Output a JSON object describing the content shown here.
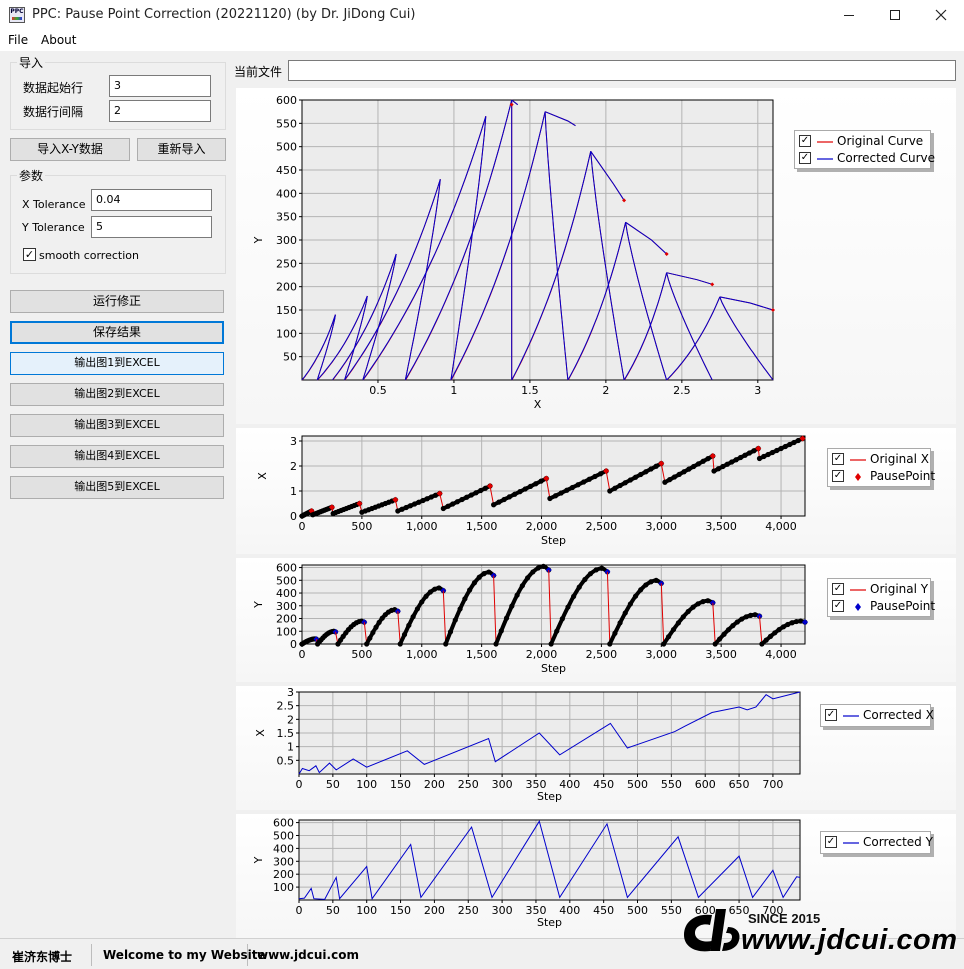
{
  "window": {
    "title": "PPC: Pause Point Correction (20221120) (by Dr. JiDong Cui)",
    "icon": "ppc-app-icon",
    "icon_text": "PPC"
  },
  "menu": {
    "file": "File",
    "about": "About"
  },
  "import_group": {
    "title": "导入",
    "start_row_label": "数据起始行",
    "start_row_value": "3",
    "row_interval_label": "数据行间隔",
    "row_interval_value": "2"
  },
  "buttons": {
    "import_xy": "导入X-Y数据",
    "reimport": "重新导入",
    "run": "运行修正",
    "save": "保存结果",
    "export1": "输出图1到EXCEL",
    "export2": "输出图2到EXCEL",
    "export3": "输出图3到EXCEL",
    "export4": "输出图4到EXCEL",
    "export5": "输出图5到EXCEL"
  },
  "params_group": {
    "title": "参数",
    "x_tol_label": "X Tolerance",
    "x_tol_value": "0.04",
    "y_tol_label": "Y Tolerance",
    "y_tol_value": "5",
    "smooth_label": "smooth correction",
    "smooth_checked": true
  },
  "current_file": {
    "label": "当前文件",
    "value": ""
  },
  "status": {
    "name": "崔济东博士",
    "welcome": "Welcome to my Website",
    "site": "www.jdcui.com"
  },
  "watermark": {
    "since": "SINCE 2015",
    "site": "www.jdcui.com"
  },
  "colors": {
    "red": "#e00000",
    "blue": "#0000cc",
    "black": "#000000",
    "focus": "#0078d7"
  },
  "chart_data": [
    {
      "type": "line",
      "xlabel": "X",
      "ylabel": "Y",
      "xlim": [
        0,
        3.1
      ],
      "ylim": [
        0,
        600
      ],
      "xticks": [
        0.5,
        1,
        1.5,
        2,
        2.5,
        3
      ],
      "yticks": [
        50,
        100,
        150,
        200,
        250,
        300,
        350,
        400,
        450,
        500,
        550,
        600
      ],
      "series": [
        {
          "name": "Original Curve",
          "color": "#e00000",
          "legend_checked": true
        },
        {
          "name": "Corrected Curve",
          "color": "#0000cc",
          "legend_checked": true
        }
      ],
      "peaks": [
        {
          "x": 0.22,
          "y": 140
        },
        {
          "x": 0.43,
          "y": 180
        },
        {
          "x": 0.62,
          "y": 270
        },
        {
          "x": 0.91,
          "y": 430
        },
        {
          "x": 1.21,
          "y": 565
        },
        {
          "x": 1.38,
          "y": 600
        },
        {
          "x": 1.6,
          "y": 575
        },
        {
          "x": 1.9,
          "y": 490
        },
        {
          "x": 2.13,
          "y": 338
        },
        {
          "x": 2.4,
          "y": 230
        },
        {
          "x": 2.75,
          "y": 178
        }
      ],
      "unload_ends": [
        {
          "x": 0.1,
          "y": 0
        },
        {
          "x": 0.28,
          "y": 0
        },
        {
          "x": 0.4,
          "y": 0
        },
        {
          "x": 0.68,
          "y": 0
        },
        {
          "x": 0.98,
          "y": 0
        },
        {
          "x": 1.38,
          "y": 0
        },
        {
          "x": 1.75,
          "y": 0
        },
        {
          "x": 2.12,
          "y": 0
        },
        {
          "x": 2.4,
          "y": 0
        }
      ],
      "tail_points": [
        {
          "x": 1.42,
          "y": 590
        },
        {
          "x": 1.8,
          "y": 545
        },
        {
          "x": 2.12,
          "y": 385
        },
        {
          "x": 2.4,
          "y": 270
        },
        {
          "x": 2.7,
          "y": 205
        },
        {
          "x": 3.1,
          "y": 150
        }
      ]
    },
    {
      "type": "line",
      "xlabel": "Step",
      "ylabel": "X",
      "xlim": [
        0,
        4200
      ],
      "ylim": [
        0,
        3.2
      ],
      "xticks": [
        "0",
        "500",
        "1,000",
        "1,500",
        "2,000",
        "2,500",
        "3,000",
        "3,500",
        "4,000"
      ],
      "yticks": [
        0,
        1,
        2,
        3
      ],
      "series": [
        {
          "name": "Original X",
          "color": "#e00000",
          "legend_checked": true
        },
        {
          "name": "PausePoint",
          "color": "#e00000",
          "marker": "diamond",
          "legend_checked": true
        }
      ],
      "cycles": [
        {
          "start": 0,
          "end": 80,
          "x0": 0.0,
          "x1": 0.2
        },
        {
          "start": 90,
          "end": 250,
          "x0": 0.05,
          "x1": 0.35
        },
        {
          "start": 260,
          "end": 480,
          "x0": 0.1,
          "x1": 0.5
        },
        {
          "start": 500,
          "end": 780,
          "x0": 0.15,
          "x1": 0.65
        },
        {
          "start": 800,
          "end": 1150,
          "x0": 0.2,
          "x1": 0.9
        },
        {
          "start": 1180,
          "end": 1570,
          "x0": 0.3,
          "x1": 1.2
        },
        {
          "start": 1600,
          "end": 2040,
          "x0": 0.45,
          "x1": 1.5
        },
        {
          "start": 2070,
          "end": 2540,
          "x0": 0.7,
          "x1": 1.8
        },
        {
          "start": 2570,
          "end": 3000,
          "x0": 1.0,
          "x1": 2.1
        },
        {
          "start": 3030,
          "end": 3430,
          "x0": 1.35,
          "x1": 2.4
        },
        {
          "start": 3440,
          "end": 3810,
          "x0": 1.8,
          "x1": 2.7
        },
        {
          "start": 3820,
          "end": 4180,
          "x0": 2.3,
          "x1": 3.1
        }
      ]
    },
    {
      "type": "line",
      "xlabel": "Step",
      "ylabel": "Y",
      "xlim": [
        0,
        4200
      ],
      "ylim": [
        0,
        620
      ],
      "xticks": [
        "0",
        "500",
        "1,000",
        "1,500",
        "2,000",
        "2,500",
        "3,000",
        "3,500",
        "4,000"
      ],
      "yticks": [
        0,
        100,
        200,
        300,
        400,
        500,
        600
      ],
      "series": [
        {
          "name": "Original Y",
          "color": "#e00000",
          "legend_checked": true
        },
        {
          "name": "PausePoint",
          "color": "#0000cc",
          "marker": "diamond",
          "legend_checked": true
        }
      ],
      "cycles": [
        {
          "start": 0,
          "end": 120,
          "peak": 40
        },
        {
          "start": 130,
          "end": 280,
          "peak": 100
        },
        {
          "start": 300,
          "end": 520,
          "peak": 180
        },
        {
          "start": 540,
          "end": 800,
          "peak": 270
        },
        {
          "start": 820,
          "end": 1180,
          "peak": 440
        },
        {
          "start": 1200,
          "end": 1600,
          "peak": 565
        },
        {
          "start": 1620,
          "end": 2060,
          "peak": 610
        },
        {
          "start": 2080,
          "end": 2550,
          "peak": 595
        },
        {
          "start": 2570,
          "end": 3000,
          "peak": 500
        },
        {
          "start": 3020,
          "end": 3430,
          "peak": 340
        },
        {
          "start": 3450,
          "end": 3820,
          "peak": 230
        },
        {
          "start": 3840,
          "end": 4200,
          "peak": 180
        }
      ]
    },
    {
      "type": "line",
      "xlabel": "Step",
      "ylabel": "X",
      "xlim": [
        0,
        740
      ],
      "ylim": [
        0,
        3
      ],
      "xticks": [
        0,
        50,
        100,
        150,
        200,
        250,
        300,
        350,
        400,
        450,
        500,
        550,
        600,
        650,
        700
      ],
      "yticks": [
        0.5,
        1,
        1.5,
        2,
        2.5,
        3
      ],
      "series": [
        {
          "name": "Corrected X",
          "color": "#0000cc",
          "legend_checked": true,
          "points": [
            [
              0,
              0
            ],
            [
              5,
              0.2
            ],
            [
              15,
              0.12
            ],
            [
              25,
              0.3
            ],
            [
              30,
              0.05
            ],
            [
              45,
              0.4
            ],
            [
              55,
              0.15
            ],
            [
              80,
              0.55
            ],
            [
              100,
              0.25
            ],
            [
              160,
              0.85
            ],
            [
              185,
              0.35
            ],
            [
              280,
              1.3
            ],
            [
              290,
              0.45
            ],
            [
              355,
              1.5
            ],
            [
              385,
              0.7
            ],
            [
              460,
              1.85
            ],
            [
              485,
              0.95
            ],
            [
              555,
              1.55
            ],
            [
              570,
              1.75
            ],
            [
              610,
              2.25
            ],
            [
              650,
              2.45
            ],
            [
              662,
              2.35
            ],
            [
              675,
              2.45
            ],
            [
              690,
              2.9
            ],
            [
              700,
              2.75
            ],
            [
              740,
              3.15
            ]
          ]
        }
      ]
    },
    {
      "type": "line",
      "xlabel": "Step",
      "ylabel": "Y",
      "xlim": [
        0,
        740
      ],
      "ylim": [
        0,
        620
      ],
      "xticks": [
        0,
        50,
        100,
        150,
        200,
        250,
        300,
        350,
        400,
        450,
        500,
        550,
        600,
        650,
        700
      ],
      "yticks": [
        100,
        200,
        300,
        400,
        500,
        600
      ],
      "series": [
        {
          "name": "Corrected Y",
          "color": "#0000cc",
          "legend_checked": true,
          "points": [
            [
              0,
              10
            ],
            [
              8,
              15
            ],
            [
              18,
              90
            ],
            [
              22,
              10
            ],
            [
              38,
              5
            ],
            [
              55,
              175
            ],
            [
              60,
              10
            ],
            [
              100,
              260
            ],
            [
              108,
              10
            ],
            [
              165,
              430
            ],
            [
              180,
              20
            ],
            [
              255,
              565
            ],
            [
              285,
              20
            ],
            [
              355,
              610
            ],
            [
              385,
              20
            ],
            [
              455,
              590
            ],
            [
              485,
              20
            ],
            [
              560,
              490
            ],
            [
              590,
              20
            ],
            [
              650,
              340
            ],
            [
              670,
              20
            ],
            [
              700,
              230
            ],
            [
              715,
              20
            ],
            [
              735,
              180
            ],
            [
              740,
              175
            ]
          ]
        }
      ]
    }
  ]
}
